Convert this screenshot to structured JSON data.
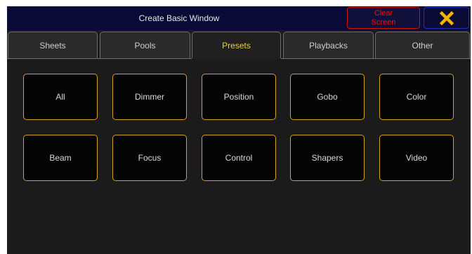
{
  "window": {
    "title": "Create Basic Window",
    "clear_screen": [
      "Clear",
      "Screen"
    ],
    "close_icon": "close-x-icon"
  },
  "tabs": [
    {
      "label": "Sheets",
      "active": false
    },
    {
      "label": "Pools",
      "active": false
    },
    {
      "label": "Presets",
      "active": true
    },
    {
      "label": "Playbacks",
      "active": false
    },
    {
      "label": "Other",
      "active": false
    }
  ],
  "presets": {
    "row1": [
      "All",
      "Dimmer",
      "Position",
      "Gobo",
      "Color"
    ],
    "row2": [
      "Beam",
      "Focus",
      "Control",
      "Shapers",
      "Video"
    ]
  },
  "colors": {
    "title_bar": "#0a0a36",
    "active_tab_text": "#f2d21a",
    "button_border": "#d8a21a",
    "clear_red": "#e01515",
    "close_x": "#f5b400"
  }
}
